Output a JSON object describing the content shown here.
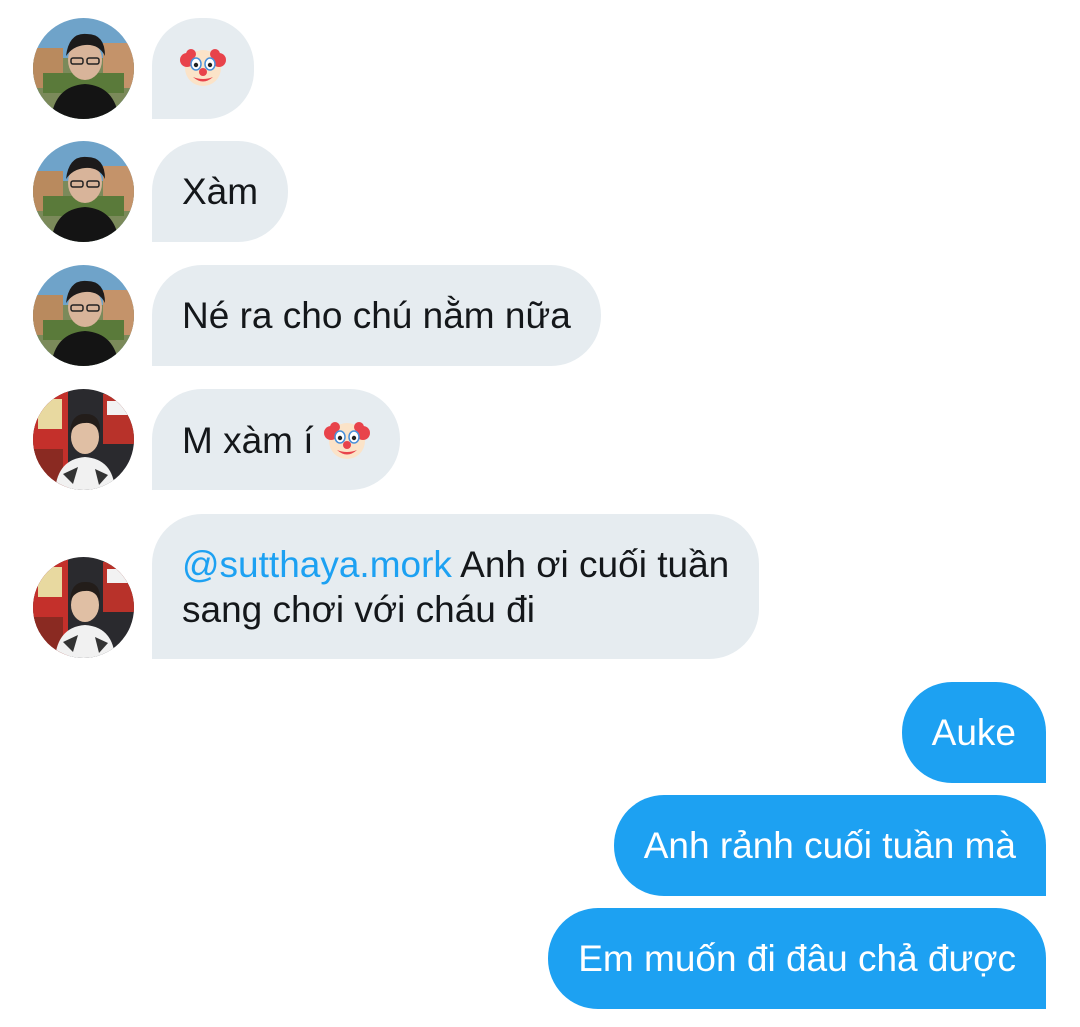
{
  "messages": [
    {
      "side": "in",
      "avatar": "avatar-outdoor-glasses",
      "emoji": "clown-face-icon",
      "text": ""
    },
    {
      "side": "in",
      "avatar": "avatar-outdoor-glasses",
      "text": "Xàm"
    },
    {
      "side": "in",
      "avatar": "avatar-outdoor-glasses",
      "text": "Né ra cho chú nằm nữa"
    },
    {
      "side": "in",
      "avatar": "avatar-store-red",
      "text": "M xàm í",
      "emoji": "clown-face-icon"
    },
    {
      "side": "in",
      "avatar": "avatar-store-red",
      "mention": "@sutthaya.mork",
      "text_line1": " Anh ơi cuối tuần",
      "text_line2": "sang chơi với cháu đi"
    },
    {
      "side": "out",
      "text": "Auke"
    },
    {
      "side": "out",
      "text": "Anh rảnh cuối tuần mà"
    },
    {
      "side": "out",
      "text": "Em muốn đi đâu chả được"
    }
  ],
  "colors": {
    "incoming_bubble": "#e6ecf0",
    "outgoing_bubble": "#1da1f2",
    "mention": "#1da1f2",
    "text_dark": "#14171a"
  }
}
